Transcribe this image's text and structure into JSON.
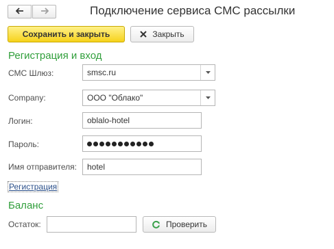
{
  "window": {
    "title": "Подключение сервиса СМС рассылки"
  },
  "toolbar": {
    "back_icon": "arrow-left-icon",
    "forward_icon": "arrow-right-icon",
    "save_close_label": "Сохранить и закрыть",
    "close_label": "Закрыть",
    "close_icon": "close-x-icon"
  },
  "registration": {
    "section_title": "Регистрация и вход",
    "gateway": {
      "label": "СМС Шлюз:",
      "value": "smsc.ru"
    },
    "company": {
      "label": "Company:",
      "value": "ООО \"Облако\""
    },
    "login": {
      "label": "Логин:",
      "value": "oblalo-hotel"
    },
    "password": {
      "label": "Пароль:",
      "masked_length": 11
    },
    "sender": {
      "label": "Имя отправителя:",
      "value": "hotel"
    },
    "register_link": "Регистрация"
  },
  "balance": {
    "section_title": "Баланс",
    "remaining": {
      "label": "Остаток:",
      "value": ""
    },
    "check_label": "Проверить",
    "check_icon": "refresh-icon"
  },
  "colors": {
    "section_title": "#2f9e3a",
    "primary_button": "#f6d21b",
    "link": "#2a4f8a",
    "refresh_icon": "#3aa14b"
  }
}
